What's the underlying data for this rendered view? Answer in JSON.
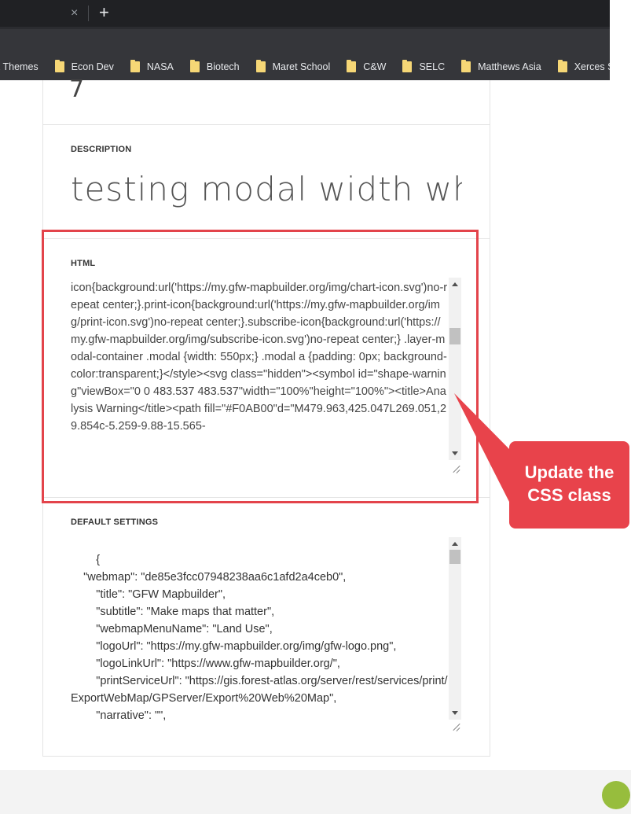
{
  "browser": {
    "tab_close": "×",
    "new_tab": "+",
    "bookmarks": [
      "k Themes",
      "Econ Dev",
      "NASA",
      "Biotech",
      "Maret School",
      "C&W",
      "SELC",
      "Matthews Asia",
      "Xerces Society"
    ]
  },
  "form": {
    "partial_value": "7",
    "description": {
      "label": "DESCRIPTION",
      "value": "testing modal width which is defined in the HTML"
    },
    "html": {
      "label": "HTML",
      "value": "icon{background:url('https://my.gfw-mapbuilder.org/img/chart-icon.svg')no-repeat center;}.print-icon{background:url('https://my.gfw-mapbuilder.org/img/print-icon.svg')no-repeat center;}.subscribe-icon{background:url('https://my.gfw-mapbuilder.org/img/subscribe-icon.svg')no-repeat center;} .layer-modal-container .modal {width: 550px;} .modal a {padding: 0px; background-color:transparent;}</style><svg class=\"hidden\"><symbol id=\"shape-warning\"viewBox=\"0 0 483.537 483.537\"width=\"100%\"height=\"100%\"><title>Analysis Warning</title><path fill=\"#F0AB00\"d=\"M479.963,425.047L269.051,29.854c-5.259-9.88-15.565-"
    },
    "default_settings": {
      "label": "DEFAULT SETTINGS",
      "value": "        {\n    \"webmap\": \"de85e3fcc07948238aa6c1afd2a4ceb0\",\n        \"title\": \"GFW Mapbuilder\",\n        \"subtitle\": \"Make maps that matter\",\n        \"webmapMenuName\": \"Land Use\",\n        \"logoUrl\": \"https://my.gfw-mapbuilder.org/img/gfw-logo.png\",\n        \"logoLinkUrl\": \"https://www.gfw-mapbuilder.org/\",\n        \"printServiceUrl\": \"https://gis.forest-atlas.org/server/rest/services/print/ExportWebMap/GPServer/Export%20Web%20Map\",\n        \"narrative\": \"\","
    }
  },
  "annotation": {
    "callout_text": "Update the CSS class",
    "color": "#e8434b"
  }
}
